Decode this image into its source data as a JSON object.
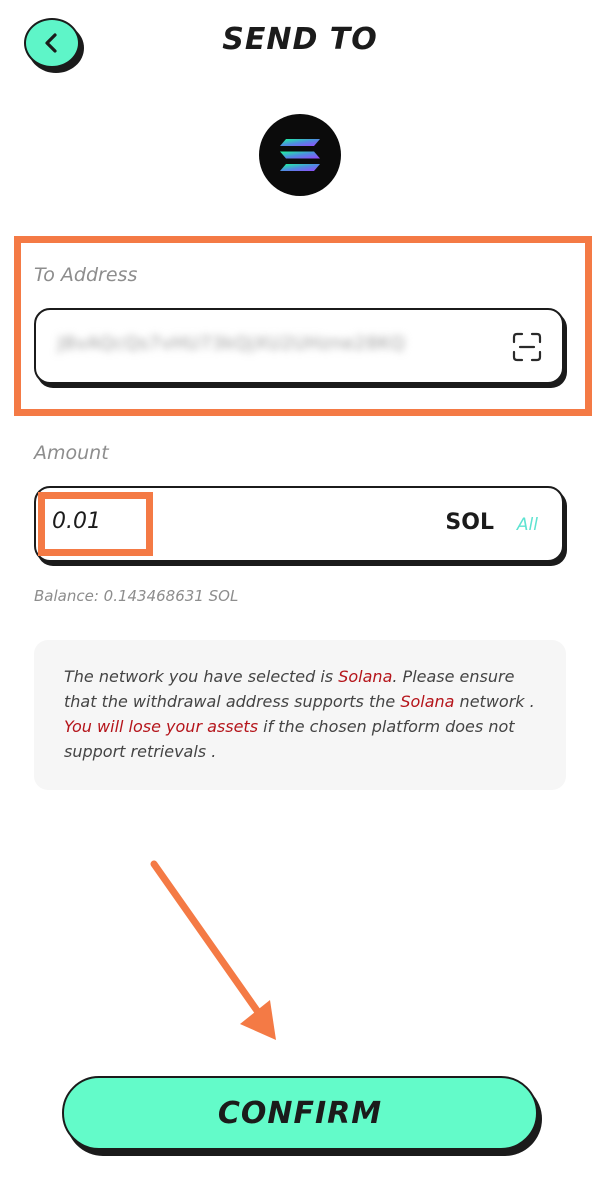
{
  "header": {
    "title": "SEND TO",
    "back_icon": "chevron-left-icon"
  },
  "token": {
    "logo_icon": "solana-logo"
  },
  "to_address": {
    "label": "To Address",
    "value": "J8vAQcQs7vHU73kQjXU2UHzne28KQ",
    "scan_icon": "scan-icon"
  },
  "amount": {
    "label": "Amount",
    "value": "0.01",
    "unit": "SOL",
    "all_label": "All"
  },
  "balance": {
    "text": "Balance: 0.143468631 SOL"
  },
  "notice": {
    "part1": "The network you have selected is ",
    "network1": "Solana",
    "part2": ". Please ensure that the withdrawal address supports the ",
    "network2": "Solana",
    "part3": " network . ",
    "warning": "You will lose your assets",
    "part4": " if the chosen platform does not support retrievals ."
  },
  "confirm": {
    "label": "CONFIRM"
  },
  "colors": {
    "accent": "#5ef5c8",
    "highlight": "#f47a45",
    "warning": "#b5151b"
  }
}
